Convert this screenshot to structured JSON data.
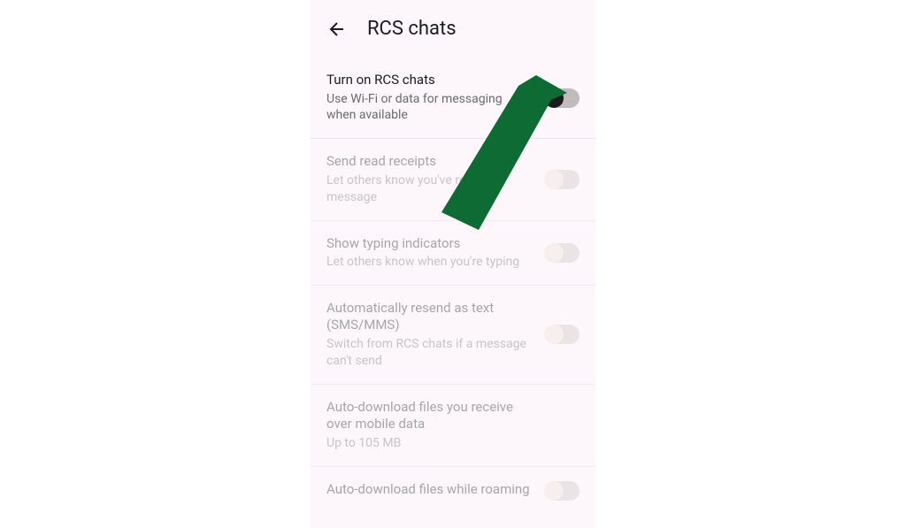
{
  "header": {
    "title": "RCS chats"
  },
  "settings": [
    {
      "title": "Turn on RCS chats",
      "subtitle": "Use Wi-Fi or data for messaging when available"
    },
    {
      "title": "Send read receipts",
      "subtitle": "Let others know you've read their message"
    },
    {
      "title": "Show typing indicators",
      "subtitle": "Let others know when you're typing"
    },
    {
      "title": "Automatically resend as text (SMS/MMS)",
      "subtitle": "Switch from RCS chats if a message can't send"
    },
    {
      "title": "Auto-download files you receive over mobile data",
      "subtitle": "Up to 105 MB"
    },
    {
      "title": "Auto-download files while roaming",
      "subtitle": ""
    }
  ]
}
